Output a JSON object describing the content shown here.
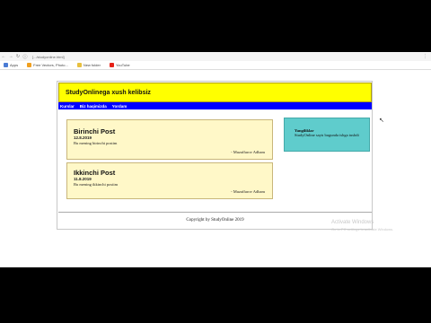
{
  "browser": {
    "url": "[.../studyonline.html]",
    "bookmarks": [
      {
        "label": "Apps",
        "color": "#4a7bd4"
      },
      {
        "label": "Free Vectors, Photo...",
        "color": "#f0a020"
      },
      {
        "label": "New folder",
        "color": "#e8c040"
      },
      {
        "label": "YouTube",
        "color": "#e62117"
      }
    ]
  },
  "site": {
    "header_title": "StudyOnlinega xush kelibsiz",
    "nav": [
      "Kurslar",
      "Biz haqimizda",
      "Yordam"
    ],
    "posts": [
      {
        "title": "Birinchi Post",
        "date": "12.8.2019",
        "text": "Bu mening birinchi postim",
        "author": "- Muzaffarov Adham"
      },
      {
        "title": "Ikkinchi Post",
        "date": "11.8.2019",
        "text": "Bu mening ikkinchi postim",
        "author": "- Muzaffarov Adham"
      }
    ],
    "aside": {
      "title": "Yangiliklar",
      "text": "StudyOnline saytı bugundа ishga tushdi"
    },
    "footer": "Copyright by StudyOnline 2019"
  },
  "watermark": {
    "title": "Activate Windows",
    "subtitle": "Go to PC settings to activate Windows."
  },
  "colors": {
    "header": "#ffff00",
    "navbar": "#0000ff",
    "post_bg": "#fff8c8",
    "aside_bg": "#5fcccc"
  }
}
